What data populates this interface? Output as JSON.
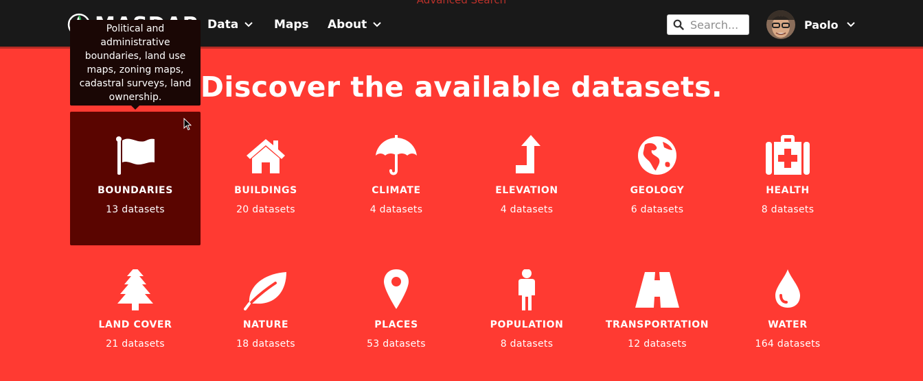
{
  "nav": {
    "advanced_search": "Advanced Search",
    "logo_text": "MASDAP",
    "items": [
      {
        "label": "Data",
        "dropdown": true
      },
      {
        "label": "Maps",
        "dropdown": false
      },
      {
        "label": "About",
        "dropdown": true
      }
    ],
    "search_placeholder": "Search...",
    "user_name": "Paolo"
  },
  "heading": "Discover the available datasets.",
  "tooltip": "Political and administrative boundaries, land use maps, zoning maps, cadastral surveys, land ownership.",
  "categories": [
    {
      "icon": "flag-icon",
      "label": "BOUNDARIES",
      "count": "13 datasets",
      "active": true
    },
    {
      "icon": "home-icon",
      "label": "BUILDINGS",
      "count": "20 datasets"
    },
    {
      "icon": "umbrella-icon",
      "label": "CLIMATE",
      "count": "4 datasets"
    },
    {
      "icon": "level-up-icon",
      "label": "ELEVATION",
      "count": "4 datasets"
    },
    {
      "icon": "globe-icon",
      "label": "GEOLOGY",
      "count": "6 datasets"
    },
    {
      "icon": "medkit-icon",
      "label": "HEALTH",
      "count": "8 datasets"
    },
    {
      "icon": "tree-icon",
      "label": "LAND COVER",
      "count": "21 datasets"
    },
    {
      "icon": "leaf-icon",
      "label": "NATURE",
      "count": "18 datasets"
    },
    {
      "icon": "map-marker-icon",
      "label": "PLACES",
      "count": "53 datasets"
    },
    {
      "icon": "person-icon",
      "label": "POPULATION",
      "count": "8 datasets"
    },
    {
      "icon": "road-icon",
      "label": "TRANSPORTATION",
      "count": "12 datasets"
    },
    {
      "icon": "drop-icon",
      "label": "WATER",
      "count": "164 datasets"
    }
  ],
  "colors": {
    "page_bg": "#ff3a32",
    "navbar_bg": "#191919",
    "active_tile_bg": "#5a0500",
    "tooltip_bg": "#1a0705"
  }
}
